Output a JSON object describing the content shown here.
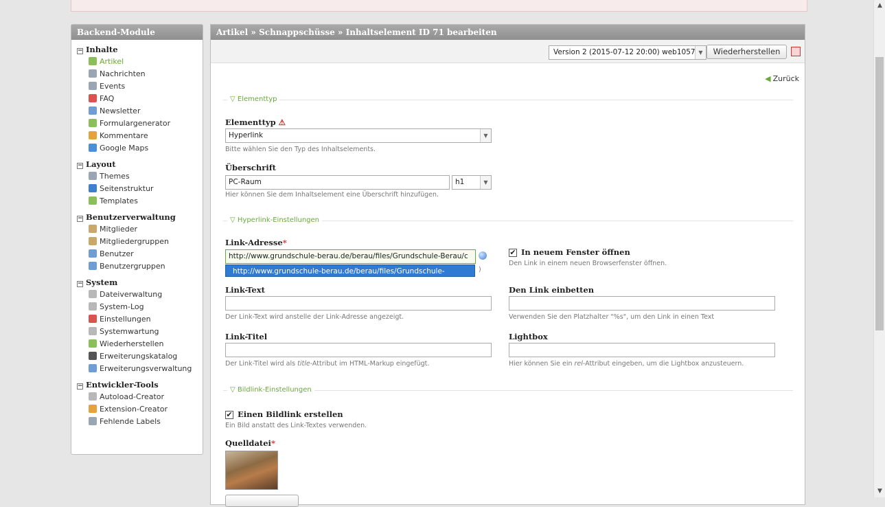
{
  "sidebar": {
    "title": "Backend-Module",
    "groups": [
      {
        "title": "Inhalte",
        "items": [
          {
            "label": "Artikel",
            "icon": "article-icon",
            "color": "#8bbf5a",
            "active": true
          },
          {
            "label": "Nachrichten",
            "icon": "clock-icon",
            "color": "#9aa6b3"
          },
          {
            "label": "Events",
            "icon": "calendar-icon",
            "color": "#9aa6b3"
          },
          {
            "label": "FAQ",
            "icon": "faq-icon",
            "color": "#d9534f"
          },
          {
            "label": "Newsletter",
            "icon": "newsletter-icon",
            "color": "#6f9ed6"
          },
          {
            "label": "Formulargenerator",
            "icon": "form-icon",
            "color": "#8bbf5a"
          },
          {
            "label": "Kommentare",
            "icon": "comment-icon",
            "color": "#e6a23c"
          },
          {
            "label": "Google Maps",
            "icon": "maps-icon",
            "color": "#4a90d9"
          }
        ]
      },
      {
        "title": "Layout",
        "items": [
          {
            "label": "Themes",
            "icon": "themes-icon",
            "color": "#9aa6b3"
          },
          {
            "label": "Seitenstruktur",
            "icon": "globe-icon",
            "color": "#3f7fcf"
          },
          {
            "label": "Templates",
            "icon": "template-icon",
            "color": "#8bbf5a"
          }
        ]
      },
      {
        "title": "Benutzerverwaltung",
        "items": [
          {
            "label": "Mitglieder",
            "icon": "member-icon",
            "color": "#c9a86a"
          },
          {
            "label": "Mitgliedergruppen",
            "icon": "member-group-icon",
            "color": "#c9a86a"
          },
          {
            "label": "Benutzer",
            "icon": "user-icon",
            "color": "#6f9ed6"
          },
          {
            "label": "Benutzergruppen",
            "icon": "user-group-icon",
            "color": "#6f9ed6"
          }
        ]
      },
      {
        "title": "System",
        "items": [
          {
            "label": "Dateiverwaltung",
            "icon": "folder-icon",
            "color": "#b8b8b8"
          },
          {
            "label": "System-Log",
            "icon": "log-icon",
            "color": "#b8b8b8"
          },
          {
            "label": "Einstellungen",
            "icon": "settings-icon",
            "color": "#d9534f"
          },
          {
            "label": "Systemwartung",
            "icon": "maintenance-icon",
            "color": "#b8b8b8"
          },
          {
            "label": "Wiederherstellen",
            "icon": "restore-icon",
            "color": "#8bbf5a"
          },
          {
            "label": "Erweiterungskatalog",
            "icon": "catalog-icon",
            "color": "#555555"
          },
          {
            "label": "Erweiterungsverwaltung",
            "icon": "extension-manager-icon",
            "color": "#6f9ed6"
          }
        ]
      },
      {
        "title": "Entwickler-Tools",
        "items": [
          {
            "label": "Autoload-Creator",
            "icon": "autoload-icon",
            "color": "#b8b8b8"
          },
          {
            "label": "Extension-Creator",
            "icon": "extension-creator-icon",
            "color": "#e6a23c"
          },
          {
            "label": "Fehlende Labels",
            "icon": "magnifier-icon",
            "color": "#9aa6b3"
          }
        ]
      }
    ]
  },
  "header": {
    "title": "Artikel » Schnappschüsse » Inhaltselement ID 71 bearbeiten"
  },
  "version": {
    "selected": "Version 2 (2015-07-12 20:00) web1057",
    "restore_label": "Wiederherstellen"
  },
  "back_label": "Zurück",
  "sections": {
    "elementtyp": "Elementtyp",
    "hyperlink": "Hyperlink-Einstellungen",
    "bildlink": "Bildlink-Einstellungen"
  },
  "fields": {
    "elementtyp": {
      "label": "Elementtyp",
      "value": "Hyperlink",
      "help": "Bitte wählen Sie den Typ des Inhaltselements."
    },
    "ueberschrift": {
      "label": "Überschrift",
      "value": "PC-Raum",
      "level": "h1",
      "help": "Hier können Sie dem Inhaltselement eine Überschrift hinzufügen."
    },
    "link_adresse": {
      "label": "Link-Adresse",
      "required": "*",
      "value": "http://www.grundschule-berau.de/berau/files/Grundschule-Berau/c",
      "suggestion": "http://www.grundschule-berau.de/berau/files/Grundschule-Berau/c...",
      "trailing": ")"
    },
    "neues_fenster": {
      "label": "In neuem Fenster öffnen",
      "checked": "✔",
      "help": "Den Link in einem neuen Browserfenster öffnen."
    },
    "link_text": {
      "label": "Link-Text",
      "value": "",
      "help": "Der Link-Text wird anstelle der Link-Adresse angezeigt."
    },
    "einbetten": {
      "label": "Den Link einbetten",
      "value": "",
      "help": "Verwenden Sie den Platzhalter \"%s\", um den Link in einen Text"
    },
    "link_titel": {
      "label": "Link-Titel",
      "value": "",
      "help_pre": "Der Link-Titel wird als ",
      "help_em": "title",
      "help_post": "-Attribut im HTML-Markup eingefügt."
    },
    "lightbox": {
      "label": "Lightbox",
      "value": "",
      "help_pre": "Hier können Sie ein ",
      "help_em": "rel",
      "help_post": "-Attribut eingeben, um die Lightbox anzusteuern."
    },
    "bildlink": {
      "label": "Einen Bildlink erstellen",
      "checked": "✔",
      "help": "Ein Bild anstatt des Link-Textes verwenden."
    },
    "quelldatei": {
      "label": "Quelldatei",
      "required": "*"
    }
  },
  "scrollbar": {
    "up": "▲",
    "down": "▼"
  }
}
